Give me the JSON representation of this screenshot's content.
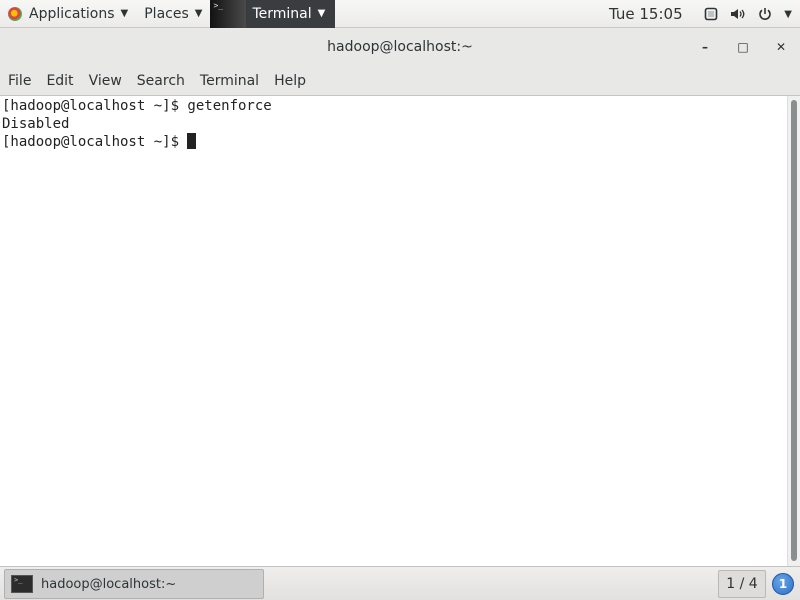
{
  "topbar": {
    "applications_label": "Applications",
    "places_label": "Places",
    "terminal_label": "Terminal",
    "clock": "Tue 15:05"
  },
  "window": {
    "title": "hadoop@localhost:~",
    "minimize_glyph": "–",
    "maximize_glyph": "□",
    "close_glyph": "✕"
  },
  "menubar": {
    "items": [
      "File",
      "Edit",
      "View",
      "Search",
      "Terminal",
      "Help"
    ]
  },
  "terminal": {
    "lines": [
      "[hadoop@localhost ~]$ getenforce",
      "Disabled",
      "[hadoop@localhost ~]$ "
    ]
  },
  "taskbar": {
    "task_label": "hadoop@localhost:~",
    "workspace": "1 / 4",
    "notification_count": "1"
  },
  "icons": {
    "apps": "gnome-foot-icon",
    "screen": "screen-icon",
    "volume": "volume-icon",
    "power": "power-icon"
  },
  "colors": {
    "topbar_bg": "#ecebea",
    "terminal_task_bg": "#3a3d3f",
    "terminal_bg": "#ffffff",
    "notification_blue": "#2a6fc9"
  }
}
